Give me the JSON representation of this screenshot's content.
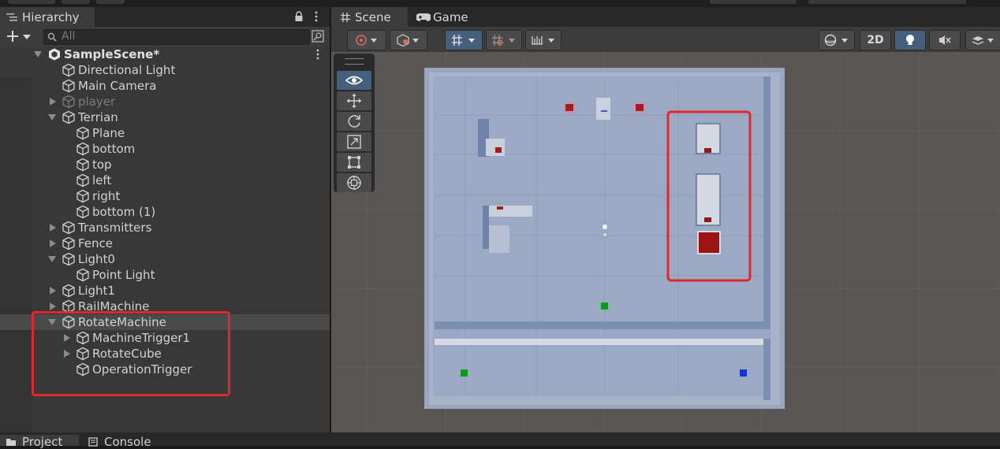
{
  "hierarchy": {
    "tab_label": "Hierarchy",
    "search_placeholder": "All",
    "rows": [
      {
        "label": "SampleScene*",
        "depth": 0,
        "state": "open",
        "kind": "scene"
      },
      {
        "label": "Directional Light",
        "depth": 1,
        "state": "none",
        "kind": "obj"
      },
      {
        "label": "Main Camera",
        "depth": 1,
        "state": "none",
        "kind": "obj"
      },
      {
        "label": "player",
        "depth": 1,
        "state": "closed",
        "kind": "obj",
        "inactive": true
      },
      {
        "label": "Terrian",
        "depth": 1,
        "state": "open",
        "kind": "obj"
      },
      {
        "label": "Plane",
        "depth": 2,
        "state": "none",
        "kind": "obj"
      },
      {
        "label": "bottom",
        "depth": 2,
        "state": "none",
        "kind": "obj"
      },
      {
        "label": "top",
        "depth": 2,
        "state": "none",
        "kind": "obj"
      },
      {
        "label": "left",
        "depth": 2,
        "state": "none",
        "kind": "obj"
      },
      {
        "label": "right",
        "depth": 2,
        "state": "none",
        "kind": "obj"
      },
      {
        "label": "bottom (1)",
        "depth": 2,
        "state": "none",
        "kind": "obj"
      },
      {
        "label": "Transmitters",
        "depth": 1,
        "state": "closed",
        "kind": "obj"
      },
      {
        "label": "Fence",
        "depth": 1,
        "state": "closed",
        "kind": "obj"
      },
      {
        "label": "Light0",
        "depth": 1,
        "state": "open",
        "kind": "obj"
      },
      {
        "label": "Point Light",
        "depth": 2,
        "state": "none",
        "kind": "obj"
      },
      {
        "label": "Light1",
        "depth": 1,
        "state": "closed",
        "kind": "obj"
      },
      {
        "label": "RailMachine",
        "depth": 1,
        "state": "closed",
        "kind": "obj"
      },
      {
        "label": "RotateMachine",
        "depth": 1,
        "state": "open",
        "kind": "obj",
        "selected": true
      },
      {
        "label": "MachineTrigger1",
        "depth": 2,
        "state": "closed",
        "kind": "obj"
      },
      {
        "label": "RotateCube",
        "depth": 2,
        "state": "closed",
        "kind": "obj"
      },
      {
        "label": "OperationTrigger",
        "depth": 2,
        "state": "none",
        "kind": "obj"
      }
    ]
  },
  "scene": {
    "tab_scene": "Scene",
    "tab_game": "Game",
    "btn_2d": "2D"
  },
  "bottom": {
    "tab_project": "Project",
    "tab_console": "Console"
  },
  "colors": {
    "highlight_box": "#e3262b",
    "accent_button": "#46607c"
  },
  "icons": [
    "hierarchy-list-icon",
    "lock-icon",
    "more-icon",
    "plus-icon",
    "search-icon",
    "unity-scene-icon",
    "cube-icon",
    "grid-icon",
    "gamepad-icon",
    "eye-icon",
    "move-icon",
    "rotate-icon",
    "scale-icon",
    "rect-icon",
    "transform-icon",
    "light-bulb-icon",
    "audio-mute-icon",
    "layers-icon"
  ]
}
